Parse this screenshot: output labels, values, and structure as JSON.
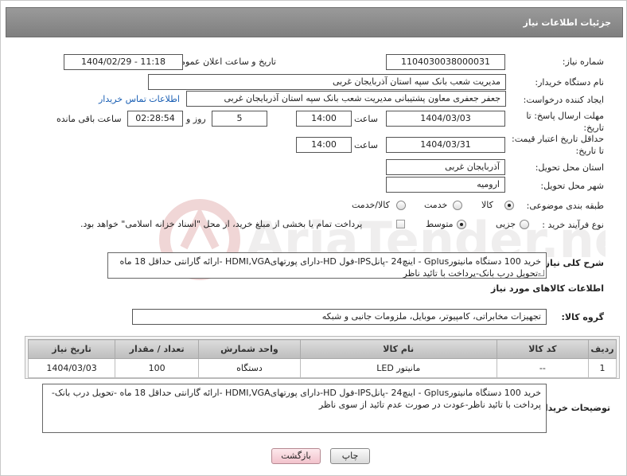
{
  "header": {
    "title": "جزئیات اطلاعات نیاز"
  },
  "fields": {
    "need_number_label": "شماره نیاز:",
    "need_number": "1104030038000031",
    "announce_label": "تاریخ و ساعت اعلان عمومی:",
    "announce_value": "1404/02/29 - 11:18",
    "buyer_org_label": "نام دستگاه خریدار:",
    "buyer_org": "مدیریت شعب بانک سپه استان آذربایجان غربی",
    "creator_label": "ایجاد کننده درخواست:",
    "creator": "جعفر جعفری معاون پشتیبانی مدیریت شعب بانک سپه استان آذربایجان غربی",
    "contact_link": "اطلاعات تماس خریدار",
    "deadline_label": "مهلت ارسال پاسخ: تا تاریخ:",
    "deadline_date": "1404/03/03",
    "time_label": "ساعت",
    "deadline_time": "14:00",
    "days_value": "5",
    "days_label": "روز و",
    "remaining_time": "02:28:54",
    "remaining_label": "ساعت باقی مانده",
    "validity_label": "حداقل تاریخ اعتبار قیمت: تا تاریخ:",
    "validity_date": "1404/03/31",
    "validity_time": "14:00",
    "province_label": "استان محل تحویل:",
    "province": "آذربایجان غربی",
    "city_label": "شهر محل تحویل:",
    "city": "ارومیه",
    "category_label": "طبقه بندی موضوعی:",
    "category_options": [
      "کالا",
      "خدمت",
      "کالا/خدمت"
    ],
    "category_selected": 0,
    "process_label": "نوع فرآیند خرید :",
    "process_options": [
      "جزیی",
      "متوسط"
    ],
    "process_selected": 1,
    "payment_note": "پرداخت تمام یا بخشی از مبلغ خرید، از محل \"اسناد خزانه اسلامی\" خواهد بود.",
    "description_label": "شرح کلی نیاز:",
    "description": "خرید 100 دستگاه مانیتورGplus - اینچ24  -پانلIPS-فول HD-دارای پورتهایHDMI,VGA -ارائه گارانتی حداقل 18 ماه -تحویل درب بانک-پرداخت با تائید ناظر",
    "goods_info_title": "اطلاعات کالاهای مورد نیاز",
    "goods_group_label": "گروه کالا:",
    "goods_group": "تجهیزات مخابراتی، کامپیوتر، موبایل، ملزومات جانبی و شبکه"
  },
  "table": {
    "headers": [
      "ردیف",
      "کد کالا",
      "نام کالا",
      "واحد شمارش",
      "تعداد / مقدار",
      "تاریخ نیاز"
    ],
    "rows": [
      [
        "1",
        "--",
        "مانیتور LED",
        "دستگاه",
        "100",
        "1404/03/03"
      ]
    ]
  },
  "buyer_notes_label": "توضیحات خریدار:",
  "buyer_notes": "خرید 100 دستگاه مانیتورGplus - اینچ24  -پانلIPS-فول HD-دارای پورتهایHDMI,VGA -ارائه گارانتی حداقل 18 ماه -تحویل درب بانک-پرداخت با تائید ناظر-عودت در صورت عدم تائید از سوی ناظر",
  "buttons": {
    "print": "چاپ",
    "back": "بازگشت"
  },
  "watermark_text": "AriaTender.neT"
}
